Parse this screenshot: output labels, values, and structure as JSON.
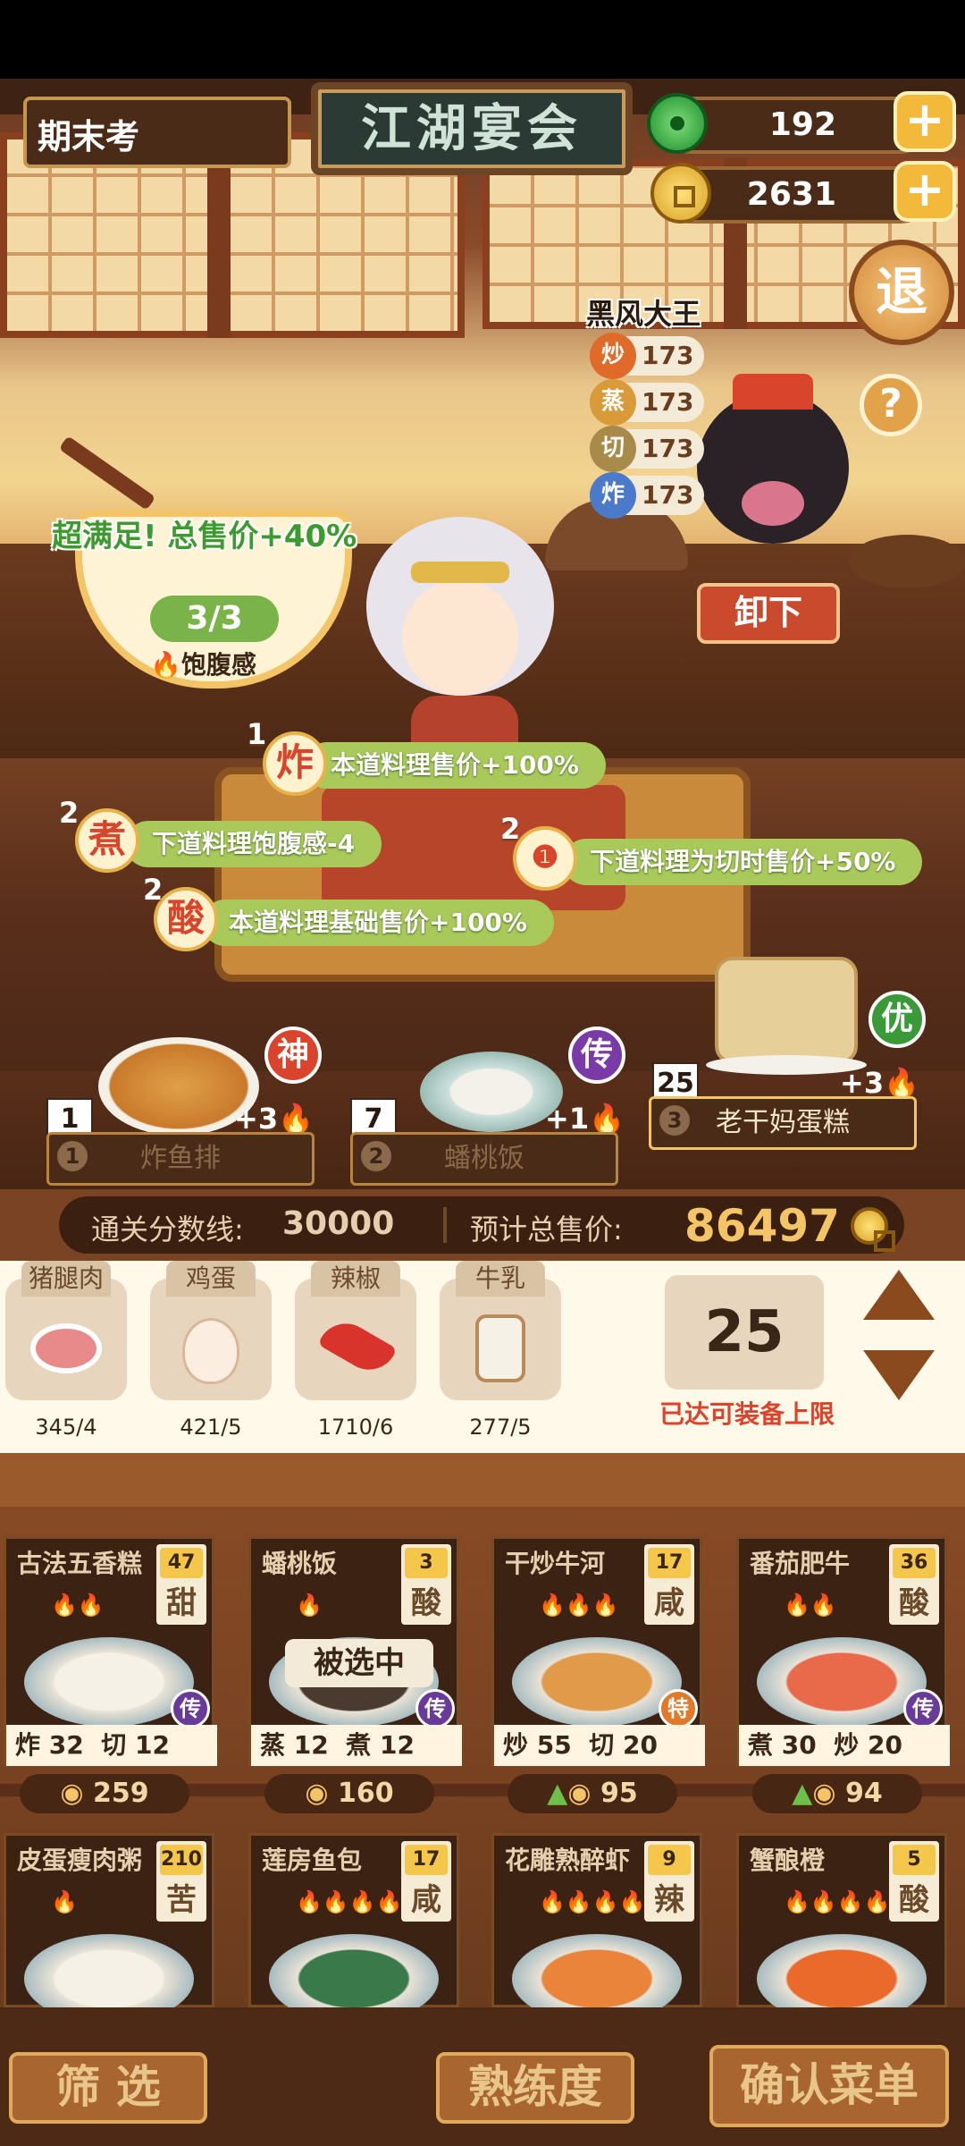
{
  "header": {
    "left_box": "期末考",
    "title_board": "江湖宴会",
    "jade_count": "192",
    "coin_count": "2631",
    "exit_label": "退"
  },
  "opponent": {
    "name": "黑风大王",
    "stats": [
      {
        "icon": "炒",
        "value": "173",
        "color": "#e06a2a"
      },
      {
        "icon": "蒸",
        "value": "173",
        "color": "#d99a3a"
      },
      {
        "icon": "切",
        "value": "173",
        "color": "#a88a4a"
      },
      {
        "icon": "炸",
        "value": "173",
        "color": "#4a7ac9"
      }
    ],
    "help_label": "?",
    "unload_label": "卸下"
  },
  "satiety": {
    "bonus_text": "超满足!  总售价+40%",
    "fraction": "3/3",
    "label": "饱腹感"
  },
  "buffs": [
    {
      "level": "1",
      "icon": "炸",
      "text": "本道料理售价+100%"
    },
    {
      "level": "2",
      "icon": "煮",
      "text": "下道料理饱腹感-4"
    },
    {
      "level": "2",
      "icon": "❶",
      "text": "下道料理为切时售价+50%"
    },
    {
      "level": "2",
      "icon": "酸",
      "text": "本道料理基础售价+100%"
    }
  ],
  "dishes_on_table": [
    {
      "slot": "1",
      "level": "1",
      "name": "炸鱼排",
      "tier": "神",
      "tier_color": "#d9452c",
      "bonus": "+3",
      "selected": false
    },
    {
      "slot": "2",
      "level": "7",
      "name": "蟠桃饭",
      "tier": "传",
      "tier_color": "#7a3aa8",
      "bonus": "+1",
      "selected": false
    },
    {
      "slot": "3",
      "level": "25",
      "name": "老干妈蛋糕",
      "tier": "优",
      "tier_color": "#3a9a3a",
      "bonus": "+3",
      "selected": true
    }
  ],
  "score": {
    "threshold_label": "通关分数线:",
    "threshold_value": "30000",
    "total_label": "预计总售价:",
    "total_value": "86497"
  },
  "ingredients": [
    {
      "name": "猪腿肉",
      "count": "345/4"
    },
    {
      "name": "鸡蛋",
      "count": "421/5"
    },
    {
      "name": "辣椒",
      "count": "1710/6"
    },
    {
      "name": "牛乳",
      "count": "277/5"
    }
  ],
  "equip": {
    "value": "25",
    "limit_text": "已达可装备上限"
  },
  "menu_cards": [
    {
      "name": "古法五香糕",
      "qty": "47",
      "taste": "甜",
      "fire": "🔥🔥",
      "tier": "传",
      "s1": "炸",
      "v1": "32",
      "s2": "切",
      "v2": "12",
      "price": "259",
      "up": false,
      "overlay": ""
    },
    {
      "name": "蟠桃饭",
      "qty": "3",
      "taste": "酸",
      "fire": "🔥",
      "tier": "传",
      "s1": "蒸",
      "v1": "12",
      "s2": "煮",
      "v2": "12",
      "price": "160",
      "up": false,
      "overlay": "被选中"
    },
    {
      "name": "干炒牛河",
      "qty": "17",
      "taste": "咸",
      "fire": "🔥🔥🔥",
      "tier": "特",
      "s1": "炒",
      "v1": "55",
      "s2": "切",
      "v2": "20",
      "price": "95",
      "up": true,
      "overlay": ""
    },
    {
      "name": "番茄肥牛",
      "qty": "36",
      "taste": "酸",
      "fire": "🔥🔥",
      "tier": "传",
      "s1": "煮",
      "v1": "30",
      "s2": "炒",
      "v2": "20",
      "price": "94",
      "up": true,
      "overlay": ""
    },
    {
      "name": "皮蛋瘦肉粥",
      "qty": "210",
      "taste": "苦",
      "fire": "🔥",
      "tier": "",
      "s1": "",
      "v1": "",
      "s2": "",
      "v2": "",
      "price": "",
      "up": false,
      "overlay": ""
    },
    {
      "name": "莲房鱼包",
      "qty": "17",
      "taste": "咸",
      "fire": "🔥🔥🔥🔥",
      "tier": "",
      "s1": "",
      "v1": "",
      "s2": "",
      "v2": "",
      "price": "",
      "up": false,
      "overlay": ""
    },
    {
      "name": "花雕熟醉虾",
      "qty": "9",
      "taste": "辣",
      "fire": "🔥🔥🔥🔥",
      "tier": "",
      "s1": "",
      "v1": "",
      "s2": "",
      "v2": "",
      "price": "",
      "up": false,
      "overlay": ""
    },
    {
      "name": "蟹酿橙",
      "qty": "5",
      "taste": "酸",
      "fire": "🔥🔥🔥🔥",
      "tier": "",
      "s1": "",
      "v1": "",
      "s2": "",
      "v2": "",
      "price": "",
      "up": false,
      "overlay": ""
    }
  ],
  "bottom": {
    "filter": "筛 选",
    "proficiency": "熟练度",
    "confirm": "确认菜单"
  }
}
